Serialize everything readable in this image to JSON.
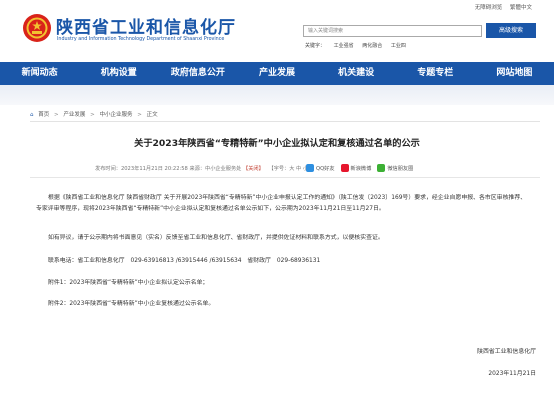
{
  "top_links": {
    "accessibility": "无障碍浏览",
    "lang": "繁體中文"
  },
  "site": {
    "title": "陕西省工业和信息化厅",
    "subtitle": "Industry and Information Technology Department of Shaanxi Province"
  },
  "search": {
    "placeholder": "输入关键词搜索",
    "button": "高级搜索",
    "keywords_label": "关键字：",
    "keywords": [
      "工业强省",
      "两化融合",
      "工业四"
    ]
  },
  "nav": [
    "新闻动态",
    "机构设置",
    "政府信息公开",
    "产业发展",
    "机关建设",
    "专题专栏",
    "网站地图"
  ],
  "breadcrumb": [
    "首页",
    "产业发展",
    "中小企业服务",
    "正文"
  ],
  "article": {
    "title": "关于2023年陕西省“专精特新”中小企业拟认定和复核通过名单的公示",
    "meta_date": "发布时间：2023年11月21日 20:22:58   来源：中小企业服务处",
    "meta_close": "【关闭】",
    "meta_font": "【字号：大 中 小】",
    "share": {
      "qzone": "QQ好友",
      "weibo": "新浪微博",
      "wechat": "微信朋友圈"
    },
    "para1": "根据《陕西省工业和信息化厅 陕西省财政厅 关于开展2023年陕西省“专精特新”中小企业申报认定工作的通知》（陕工信发〔2023〕169号）要求，经企业自愿申报、各市区审核推荐、专家评审等程序，现将2023年陕西省“专精特新”中小企业拟认定和复核通过名单公示如下，公示期为2023年11月21日至11月27日。",
    "para2": "如有异议，请于公示期内将书面意见（实名）反馈至省工业和信息化厅、省财政厅，并提供佐证材料和联系方式，以便核实查证。",
    "contact": "联系电话：省工业和信息化厅　029-63916813 /63915446 /63915634　省财政厅　029-68936131",
    "attach1": "附件1：2023年陕西省“专精特新”中小企业拟认定公示名单；",
    "attach2": "附件2：2023年陕西省“专精特新”中小企业复核通过公示名单。",
    "sign": "陕西省工业和信息化厅",
    "date": "2023年11月21日"
  },
  "colors": {
    "brand": "#1a56a8",
    "emblem": "#d9231a"
  }
}
